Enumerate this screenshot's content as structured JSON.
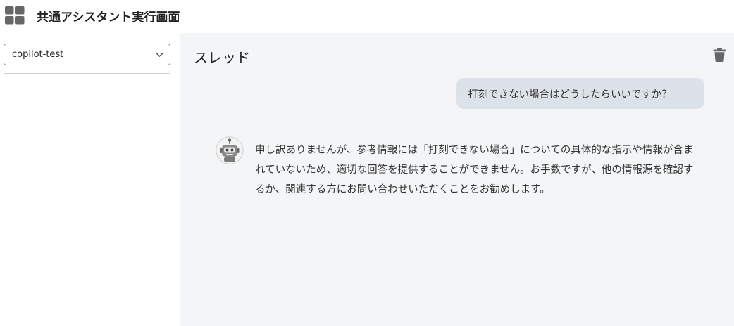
{
  "app": {
    "title": "共通アシスタント実行画面",
    "icon": "grid-icon"
  },
  "sidebar": {
    "assistant_select": {
      "selected": "copilot-test",
      "icon": "chevron-down-icon"
    }
  },
  "thread": {
    "title": "スレッド",
    "delete_icon": "trash-icon",
    "messages": [
      {
        "role": "user",
        "text": "打刻できない場合はどうしたらいいですか？"
      },
      {
        "role": "assistant",
        "avatar": "robot-icon",
        "text": "申し訳ありませんが、参考情報には「打刻できない場合」についての具体的な指示や情報が含まれていないため、適切な回答を提供することができません。お手数ですが、他の情報源を確認するか、関連する方にお問い合わせいただくことをお勧めします。"
      }
    ]
  },
  "colors": {
    "main_background": "#f4f5f7",
    "user_bubble": "#dde2e8",
    "icon_gray": "#666666"
  }
}
